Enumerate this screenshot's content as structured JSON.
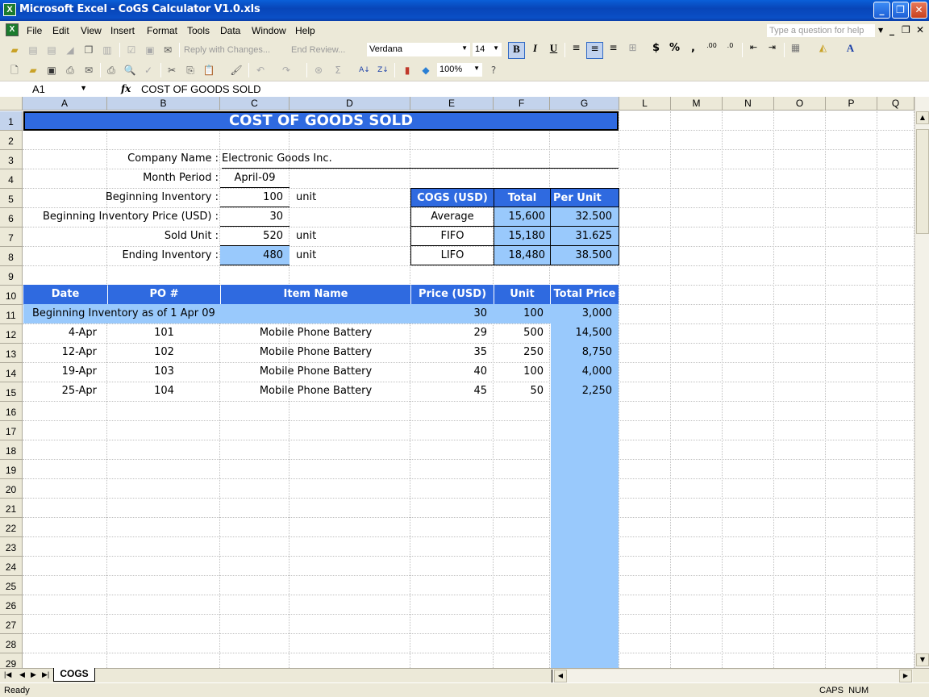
{
  "window": {
    "title": "Microsoft Excel - CoGS Calculator V1.0.xls",
    "controls": [
      "minimize",
      "restore",
      "close"
    ]
  },
  "menubar": {
    "items": [
      "File",
      "Edit",
      "View",
      "Insert",
      "Format",
      "Tools",
      "Data",
      "Window",
      "Help"
    ],
    "help_placeholder": "Type a question for help"
  },
  "toolbar_reviewing": {
    "reply_label": "Reply with Changes...",
    "end_review_label": "End Review..."
  },
  "toolbar_format": {
    "font": "Verdana",
    "size": "14",
    "bold_active": true,
    "align_center_active": true
  },
  "toolbar_standard": {
    "zoom": "100%"
  },
  "formula_bar": {
    "name_box": "A1",
    "fx": "fx",
    "formula": "COST OF GOODS SOLD"
  },
  "columns": [
    "A",
    "B",
    "C",
    "D",
    "E",
    "F",
    "G",
    "L",
    "M",
    "N",
    "O",
    "P",
    "Q"
  ],
  "rows": [
    "1",
    "2",
    "3",
    "4",
    "5",
    "6",
    "7",
    "8",
    "9",
    "10",
    "11",
    "12",
    "13",
    "14",
    "15",
    "16",
    "17",
    "18",
    "19",
    "20",
    "21",
    "22",
    "23",
    "24",
    "25",
    "26",
    "27",
    "28",
    "29"
  ],
  "sheet": {
    "title": "COST OF GOODS SOLD",
    "info": {
      "company_label": "Company Name :",
      "company_value": "Electronic Goods Inc.",
      "month_label": "Month Period :",
      "month_value": "April-09",
      "begin_inv_label": "Beginning Inventory :",
      "begin_inv_value": "100",
      "begin_price_label": "Beginning Inventory Price (USD) :",
      "begin_price_value": "30",
      "sold_label": "Sold Unit :",
      "sold_value": "520",
      "ending_label": "Ending Inventory :",
      "ending_value": "480",
      "unit": "unit"
    },
    "cogs_table": {
      "headers": [
        "COGS (USD)",
        "Total",
        "Per Unit"
      ],
      "rows": [
        {
          "method": "Average",
          "total": "15,600",
          "per_unit": "32.500"
        },
        {
          "method": "FIFO",
          "total": "15,180",
          "per_unit": "31.625"
        },
        {
          "method": "LIFO",
          "total": "18,480",
          "per_unit": "38.500"
        }
      ]
    },
    "purchase_table": {
      "headers": [
        "Date",
        "PO #",
        "Item Name",
        "Price (USD)",
        "Unit",
        "Total Price"
      ],
      "beginning_row": {
        "label": "Beginning Inventory as of  1 Apr 09",
        "price": "30",
        "unit": "100",
        "total": "3,000"
      },
      "rows": [
        {
          "date": "4-Apr",
          "po": "101",
          "item": "Mobile Phone Battery",
          "price": "29",
          "unit": "500",
          "total": "14,500"
        },
        {
          "date": "12-Apr",
          "po": "102",
          "item": "Mobile Phone Battery",
          "price": "35",
          "unit": "250",
          "total": "8,750"
        },
        {
          "date": "19-Apr",
          "po": "103",
          "item": "Mobile Phone Battery",
          "price": "40",
          "unit": "100",
          "total": "4,000"
        },
        {
          "date": "25-Apr",
          "po": "104",
          "item": "Mobile Phone Battery",
          "price": "45",
          "unit": "50",
          "total": "2,250"
        }
      ]
    }
  },
  "tabs": {
    "sheet_tabs": [
      "COGS"
    ],
    "active": "COGS"
  },
  "status": {
    "left": "Ready",
    "indicators": "CAPS  NUM"
  },
  "colors": {
    "header_blue": "#2f6ae0",
    "light_blue": "#99c9fc",
    "chrome": "#ece9d8"
  }
}
